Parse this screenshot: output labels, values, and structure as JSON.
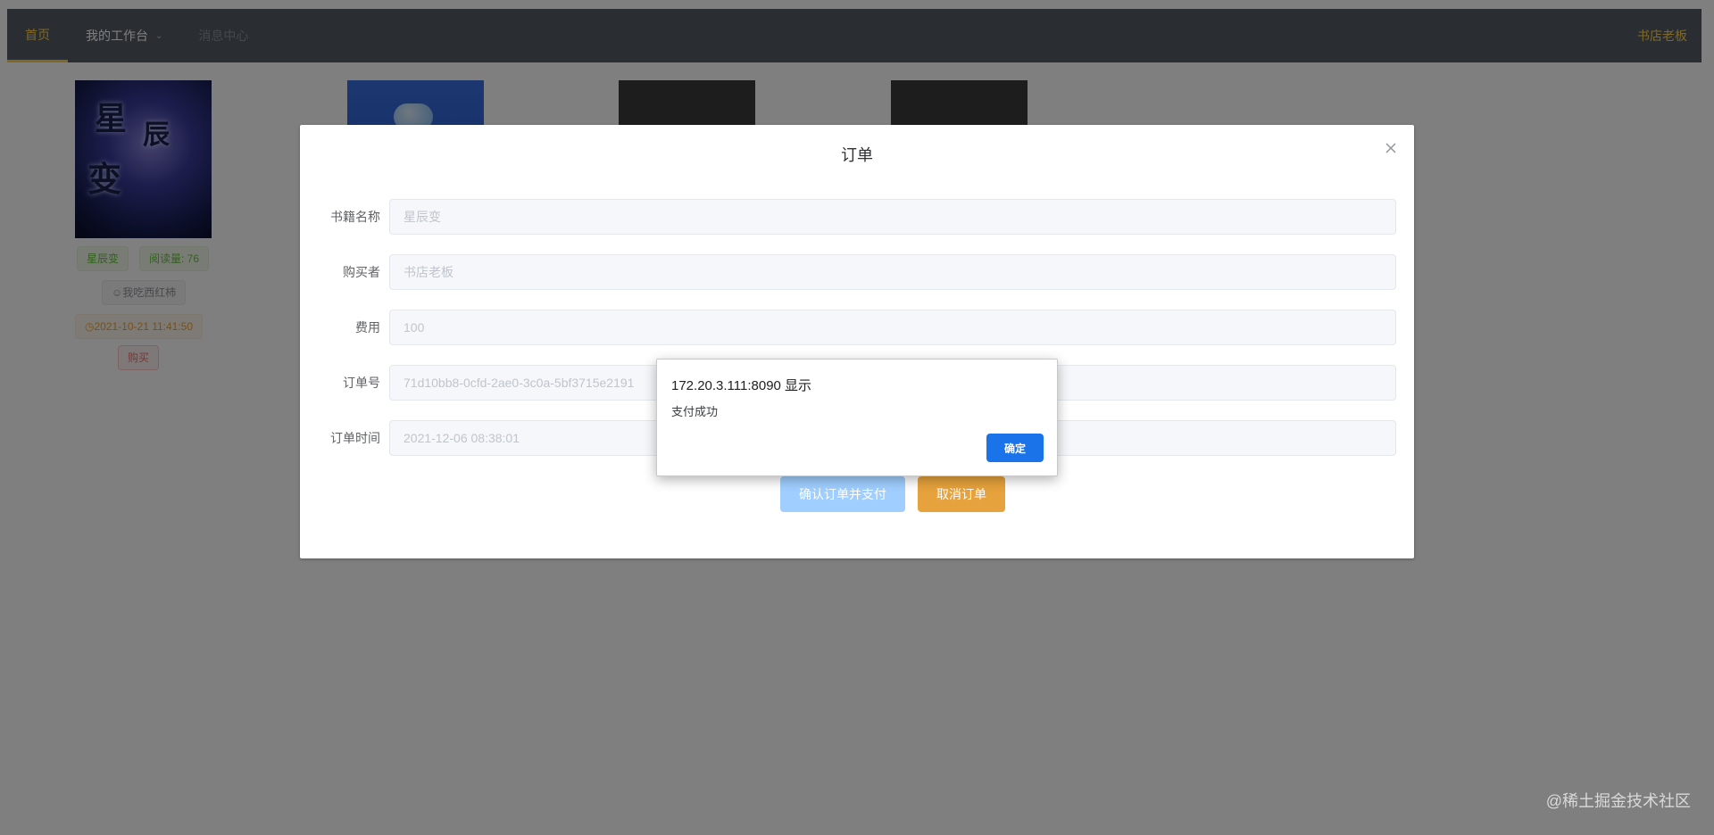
{
  "nav": {
    "items": [
      {
        "label": "首页"
      },
      {
        "label": "我的工作台"
      },
      {
        "label": "消息中心"
      }
    ],
    "user": "书店老板"
  },
  "books": [
    {
      "cover_text": [
        "星",
        "辰",
        "变"
      ],
      "title_tag": "星辰变",
      "read_tag": "阅读量: 76",
      "author_tag": "我吃西红柿",
      "time_tag": "2021-10-21 11:41:50",
      "buy_label": "购买"
    }
  ],
  "dialog": {
    "title": "订单",
    "fields": [
      {
        "label": "书籍名称",
        "value": "星辰变"
      },
      {
        "label": "购买者",
        "value": "书店老板"
      },
      {
        "label": "费用",
        "value": "100"
      },
      {
        "label": "订单号",
        "value": "71d10bb8-0cfd-2ae0-3c0a-5bf3715e2191"
      },
      {
        "label": "订单时间",
        "value": "2021-12-06 08:38:01"
      }
    ],
    "confirm_label": "确认订单并支付",
    "cancel_label": "取消订单"
  },
  "alert": {
    "title": "172.20.3.111:8090 显示",
    "message": "支付成功",
    "ok_label": "确定"
  },
  "watermark": "@稀土掘金技术社区",
  "colors": {
    "nav_bg": "#545c64",
    "nav_active": "#ffd04b",
    "primary_button": "#a0cfff",
    "warning_button": "#e6a23c",
    "alert_ok": "#1a73e8"
  }
}
